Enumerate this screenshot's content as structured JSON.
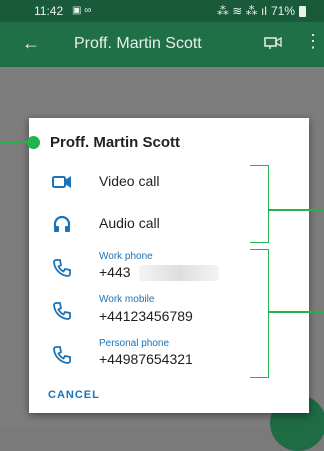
{
  "status_bar": {
    "time": "11:42",
    "left_icons": "▣ ∞",
    "right_icons": "⁂ ≋ ⁂ ıl",
    "battery": "71%"
  },
  "app_bar": {
    "title": "Proff. Martin Scott"
  },
  "dialog": {
    "title": "Proff. Martin Scott",
    "actions": [
      {
        "label": "Video call",
        "icon": "videocam-icon"
      },
      {
        "label": "Audio call",
        "icon": "headphones-icon"
      }
    ],
    "phones": [
      {
        "type": "Work phone",
        "number": "+443"
      },
      {
        "type": "Work mobile",
        "number": "+44123456789"
      },
      {
        "type": "Personal phone",
        "number": "+44987654321"
      }
    ],
    "cancel_label": "CANCEL"
  },
  "colors": {
    "primary_dark": "#185a3a",
    "primary": "#1f6f47",
    "accent": "#1a73b8",
    "annotation": "#27b04e"
  }
}
